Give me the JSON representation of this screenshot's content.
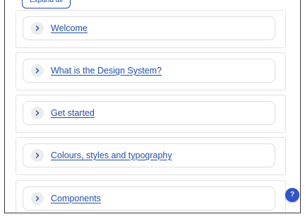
{
  "expand_button": {
    "label": "Expand all"
  },
  "accordion": {
    "items": [
      {
        "label": "Welcome"
      },
      {
        "label": "What is the Design System?"
      },
      {
        "label": "Get started"
      },
      {
        "label": "Colours, styles and typography"
      },
      {
        "label": "Components"
      }
    ]
  },
  "help_button": {
    "label": "?"
  },
  "colors": {
    "link": "#1f4fa8",
    "help": "#2f55c8"
  },
  "icons": {
    "chevron": "chevron-right-icon"
  }
}
